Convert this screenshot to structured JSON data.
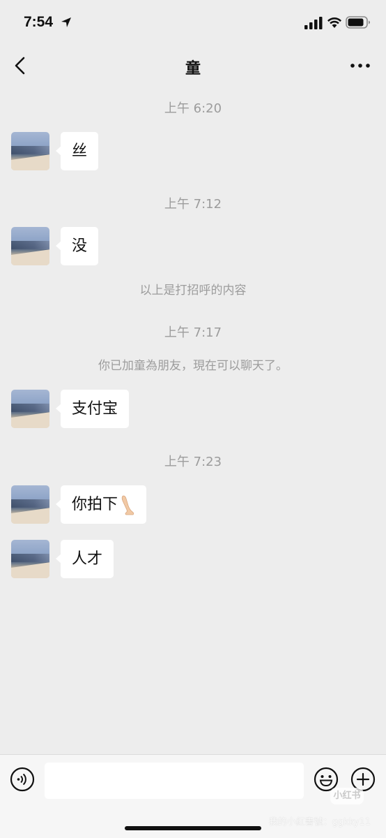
{
  "status_bar": {
    "time": "7:54",
    "icons": [
      "location-arrow-icon",
      "cellular-signal-icon",
      "wifi-icon",
      "battery-icon"
    ]
  },
  "nav": {
    "title": "童",
    "back_icon": "chevron-left-icon",
    "more_icon": "more-dots-icon"
  },
  "chat": {
    "items": [
      {
        "kind": "time",
        "text": "上午 6:20"
      },
      {
        "kind": "message",
        "text": "丝"
      },
      {
        "kind": "time",
        "text": "上午 7:12"
      },
      {
        "kind": "message",
        "text": "没"
      },
      {
        "kind": "system",
        "text": "以上是打招呼的内容"
      },
      {
        "kind": "time",
        "text": "上午 7:17"
      },
      {
        "kind": "system",
        "text": "你已加童為朋友，現在可以聊天了。"
      },
      {
        "kind": "message",
        "text": "支付宝"
      },
      {
        "kind": "time",
        "text": "上午 7:23"
      },
      {
        "kind": "message",
        "text": "你拍下",
        "emoji": "leg-emoji"
      },
      {
        "kind": "message",
        "text": "人才"
      }
    ]
  },
  "input_bar": {
    "value": "",
    "placeholder": "",
    "voice_icon": "voice-icon",
    "emoji_icon": "smiley-icon",
    "plus_icon": "plus-circle-icon"
  },
  "watermark": {
    "badge": "小红书",
    "text": "我的小紅書號：ggkky11"
  },
  "colors": {
    "background": "#ededed",
    "bubble": "#ffffff",
    "muted_text": "#9c9c9c",
    "input_bar": "#f6f6f6"
  }
}
